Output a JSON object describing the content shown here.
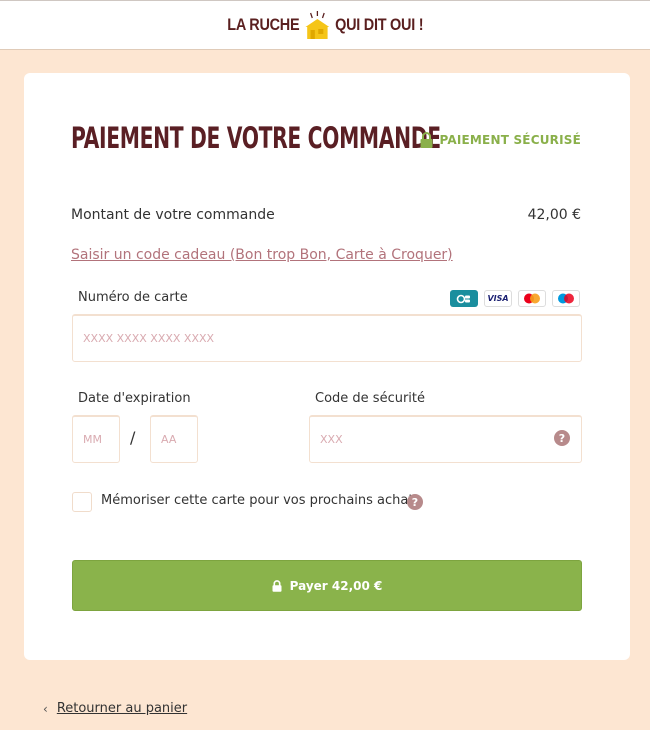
{
  "header": {
    "logo_left": "LA RUCHE",
    "logo_right": "QUI DIT OUI !"
  },
  "payment": {
    "title": "PAIEMENT DE VOTRE COMMANDE",
    "secure_label": "PAIEMENT SÉCURISÉ",
    "amount_label": "Montant de votre commande",
    "amount_value": "42,00 €",
    "gift_link": "Saisir un code cadeau (Bon trop Bon, Carte à Croquer)",
    "card_label": "Numéro de carte",
    "card_placeholder": "XXXX XXXX XXXX XXXX",
    "card_brands": [
      {
        "name": "CB",
        "icon": "cb-card-icon"
      },
      {
        "name": "VISA",
        "icon": "visa-card-icon"
      },
      {
        "name": "Mastercard",
        "icon": "mastercard-icon"
      },
      {
        "name": "Maestro",
        "icon": "maestro-icon"
      }
    ],
    "expiration_label": "Date d'expiration",
    "month_placeholder": "MM",
    "year_placeholder": "AA",
    "date_separator": "/",
    "cvc_label": "Code de sécurité",
    "cvc_placeholder": "XXX",
    "remember_label": "Mémoriser cette carte pour vos prochains achats",
    "pay_button": "Payer 42,00 €"
  },
  "footer": {
    "back_chevron": "‹",
    "back_link": "Retourner au panier"
  },
  "colors": {
    "background": "#fde6d2",
    "title": "#5a1f24",
    "accent_green": "#8ab34b",
    "link": "#b2737b",
    "placeholder": "#d9aab0"
  }
}
